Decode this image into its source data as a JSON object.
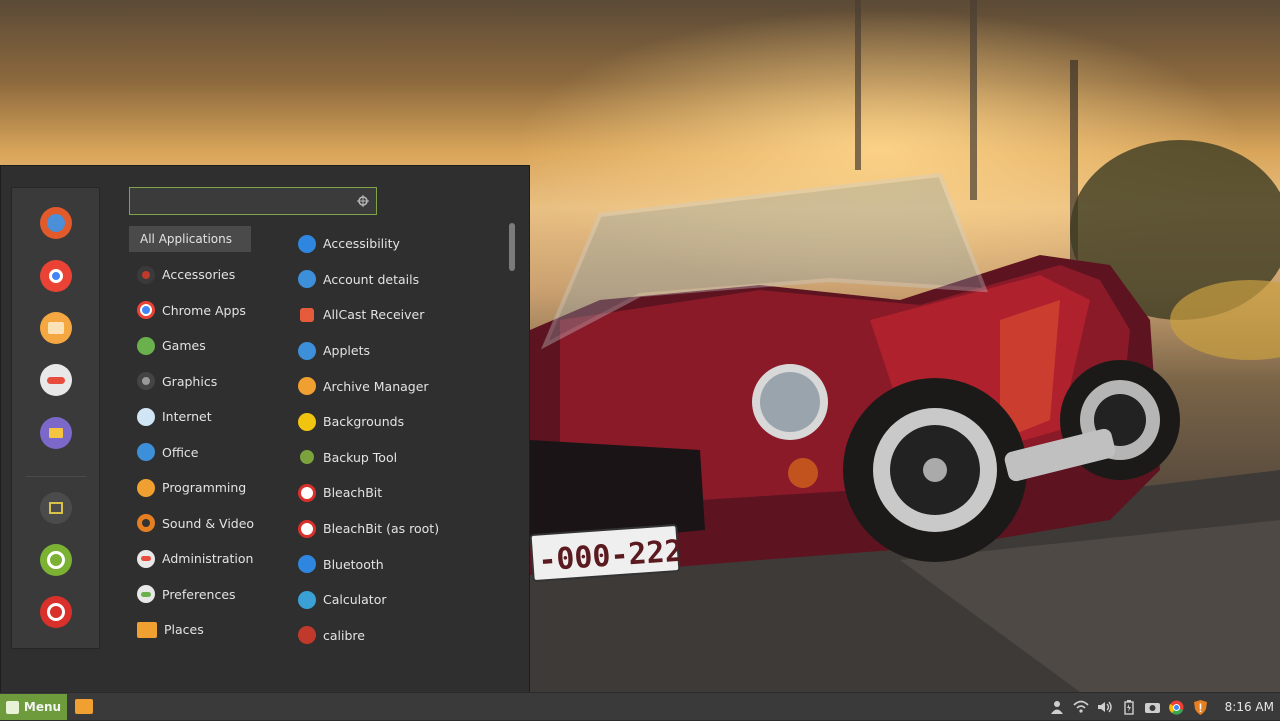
{
  "search": {
    "value": "",
    "placeholder": ""
  },
  "favorites": [
    "firefox-icon",
    "chrome-icon",
    "files-icon",
    "settings-icon",
    "file-manager-icon",
    "lock-screen-icon",
    "logout-icon",
    "power-icon"
  ],
  "categories": [
    {
      "label": "All Applications",
      "icon": "all-apps-icon",
      "color": "#4a4a4a"
    },
    {
      "label": "Accessories",
      "icon": "accessories-icon",
      "color": "#c0392b"
    },
    {
      "label": "Chrome Apps",
      "icon": "chrome-icon",
      "color": "#e74c3c"
    },
    {
      "label": "Games",
      "icon": "games-icon",
      "color": "#6ab04c"
    },
    {
      "label": "Graphics",
      "icon": "graphics-icon",
      "color": "#555555"
    },
    {
      "label": "Internet",
      "icon": "internet-icon",
      "color": "#d0e6f5"
    },
    {
      "label": "Office",
      "icon": "office-icon",
      "color": "#3d8fd9"
    },
    {
      "label": "Programming",
      "icon": "programming-icon",
      "color": "#f0a030"
    },
    {
      "label": "Sound & Video",
      "icon": "sound-video-icon",
      "color": "#e67e22"
    },
    {
      "label": "Administration",
      "icon": "administration-icon",
      "color": "#e8e8e8"
    },
    {
      "label": "Preferences",
      "icon": "preferences-icon",
      "color": "#e8e8e8"
    },
    {
      "label": "Places",
      "icon": "places-icon",
      "color": "#f0a030"
    }
  ],
  "apps": [
    {
      "label": "Accessibility",
      "icon": "accessibility-icon",
      "color": "#2e86de"
    },
    {
      "label": "Account details",
      "icon": "account-details-icon",
      "color": "#3d8fd9"
    },
    {
      "label": "AllCast Receiver",
      "icon": "allcast-icon",
      "color": "#e55b3c"
    },
    {
      "label": "Applets",
      "icon": "applets-icon",
      "color": "#3d8fd9"
    },
    {
      "label": "Archive Manager",
      "icon": "archive-manager-icon",
      "color": "#f0a030"
    },
    {
      "label": "Backgrounds",
      "icon": "backgrounds-icon",
      "color": "#f1c40f"
    },
    {
      "label": "Backup Tool",
      "icon": "backup-tool-icon",
      "color": "#7ca23e"
    },
    {
      "label": "BleachBit",
      "icon": "bleachbit-icon",
      "color": "#ffffff"
    },
    {
      "label": "BleachBit (as root)",
      "icon": "bleachbit-root-icon",
      "color": "#ffffff"
    },
    {
      "label": "Bluetooth",
      "icon": "bluetooth-icon",
      "color": "#2e86de"
    },
    {
      "label": "Calculator",
      "icon": "calculator-icon",
      "color": "#3aa0d6"
    },
    {
      "label": "calibre",
      "icon": "calibre-icon",
      "color": "#c0392b"
    }
  ],
  "taskbar": {
    "menu_label": "Menu",
    "clock": "8:16 AM",
    "tray": [
      "user-icon",
      "network-icon",
      "volume-icon",
      "battery-icon",
      "screenshot-icon",
      "chrome-icon",
      "update-shield-icon"
    ]
  },
  "colors": {
    "accent": "#6e9b3b",
    "menu_bg": "#2f2f2f",
    "panel_bg": "#3a3a3a"
  }
}
